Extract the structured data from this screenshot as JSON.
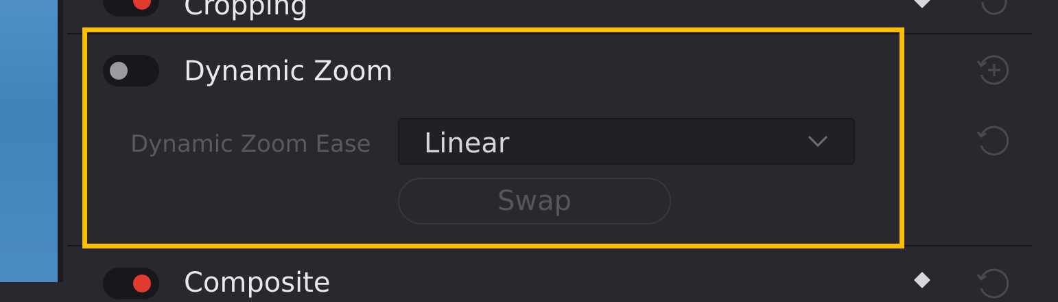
{
  "sections": {
    "cropping": {
      "title": "Cropping",
      "enabled": true
    },
    "dynamic_zoom": {
      "title": "Dynamic Zoom",
      "enabled": false,
      "ease_label": "Dynamic Zoom Ease",
      "ease_value": "Linear",
      "swap_label": "Swap"
    },
    "composite": {
      "title": "Composite",
      "enabled": true
    }
  },
  "colors": {
    "highlight": "#fbbf02",
    "toggle_on": "#e23a2f",
    "toggle_off": "#9a9a9f",
    "panel_bg": "#28282e"
  },
  "icons": {
    "reset": "reset-icon",
    "add_keyframe": "add-keyframe-icon",
    "keyframe": "keyframe-diamond-icon",
    "dropdown": "chevron-down-icon"
  }
}
